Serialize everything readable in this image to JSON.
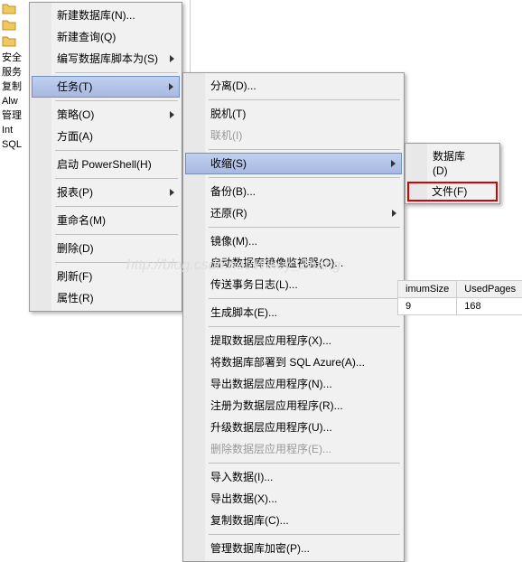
{
  "leftTree": {
    "labels": [
      "安全",
      "服务",
      "复制",
      "Alw",
      "管理",
      "Int",
      "SQL"
    ]
  },
  "menu1": {
    "items": [
      {
        "label": "新建数据库(N)...",
        "key": "new-db"
      },
      {
        "label": "新建查询(Q)",
        "key": "new-query"
      },
      {
        "label": "编写数据库脚本为(S)",
        "key": "script-db",
        "submenu": true
      },
      {
        "sep": true
      },
      {
        "label": "任务(T)",
        "key": "tasks",
        "submenu": true,
        "highlighted": true
      },
      {
        "sep": true
      },
      {
        "label": "策略(O)",
        "key": "policy",
        "submenu": true
      },
      {
        "label": "方面(A)",
        "key": "facet"
      },
      {
        "sep": true
      },
      {
        "label": "启动 PowerShell(H)",
        "key": "powershell"
      },
      {
        "sep": true
      },
      {
        "label": "报表(P)",
        "key": "reports",
        "submenu": true
      },
      {
        "sep": true
      },
      {
        "label": "重命名(M)",
        "key": "rename"
      },
      {
        "sep": true
      },
      {
        "label": "删除(D)",
        "key": "delete"
      },
      {
        "sep": true
      },
      {
        "label": "刷新(F)",
        "key": "refresh"
      },
      {
        "label": "属性(R)",
        "key": "properties"
      }
    ]
  },
  "menu2": {
    "items": [
      {
        "label": "分离(D)...",
        "key": "detach"
      },
      {
        "sep": true
      },
      {
        "label": "脱机(T)",
        "key": "offline"
      },
      {
        "label": "联机(I)",
        "key": "online",
        "disabled": true
      },
      {
        "sep": true
      },
      {
        "label": "收缩(S)",
        "key": "shrink",
        "submenu": true,
        "highlighted": true
      },
      {
        "sep": true
      },
      {
        "label": "备份(B)...",
        "key": "backup"
      },
      {
        "label": "还原(R)",
        "key": "restore",
        "submenu": true
      },
      {
        "sep": true
      },
      {
        "label": "镜像(M)...",
        "key": "mirror"
      },
      {
        "label": "启动数据库镜像监视器(O)...",
        "key": "mirror-monitor"
      },
      {
        "label": "传送事务日志(L)...",
        "key": "ship-log"
      },
      {
        "sep": true
      },
      {
        "label": "生成脚本(E)...",
        "key": "gen-script"
      },
      {
        "sep": true
      },
      {
        "label": "提取数据层应用程序(X)...",
        "key": "extract-dac"
      },
      {
        "label": "将数据库部署到 SQL Azure(A)...",
        "key": "deploy-azure"
      },
      {
        "label": "导出数据层应用程序(N)...",
        "key": "export-dac"
      },
      {
        "label": "注册为数据层应用程序(R)...",
        "key": "register-dac"
      },
      {
        "label": "升级数据层应用程序(U)...",
        "key": "upgrade-dac"
      },
      {
        "label": "删除数据层应用程序(E)...",
        "key": "delete-dac",
        "disabled": true
      },
      {
        "sep": true
      },
      {
        "label": "导入数据(I)...",
        "key": "import-data"
      },
      {
        "label": "导出数据(X)...",
        "key": "export-data"
      },
      {
        "label": "复制数据库(C)...",
        "key": "copy-db"
      },
      {
        "sep": true
      },
      {
        "label": "管理数据库加密(P)...",
        "key": "manage-encrypt"
      }
    ]
  },
  "menu3": {
    "items": [
      {
        "label": "数据库(D)",
        "key": "shrink-db"
      },
      {
        "label": "文件(F)",
        "key": "shrink-file",
        "redbox": true
      }
    ]
  },
  "table": {
    "headers": [
      "imumSize",
      "UsedPages"
    ],
    "row": [
      "9",
      "168"
    ]
  },
  "watermark": "http://blog.csdn.net/Wikey_Zhang"
}
